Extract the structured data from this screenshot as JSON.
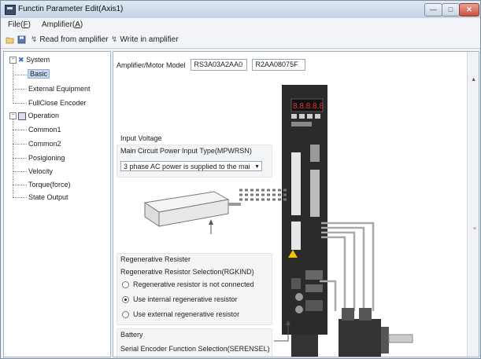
{
  "window": {
    "title": "Functin Parameter Edit(Axis1)"
  },
  "menu": [
    {
      "label": "File(",
      "key": "F",
      "suffix": ")"
    },
    {
      "label": "Amplifier(",
      "key": "A",
      "suffix": ")"
    }
  ],
  "toolbar": {
    "read_label": "Read from amplifier",
    "write_label": "Write in amplifier"
  },
  "tree": {
    "system": "System",
    "system_children": [
      "Basic",
      "External Equipment",
      "FullClose Encoder"
    ],
    "operation": "Operation",
    "operation_children": [
      "Common1",
      "Common2",
      "Posigioning",
      "Velocity",
      "Torque(force)",
      "State Output"
    ]
  },
  "model": {
    "label": "Amplifier/Motor Model",
    "amplifier": "RS3A03A2AA0",
    "motor": "R2AA08075F"
  },
  "input_voltage": {
    "title": "Input Voltage",
    "label": "Main Circuit Power Input Type(MPWRSN)",
    "value": "3 phase AC power is supplied to the mai"
  },
  "regen": {
    "title": "Regenerative Resister",
    "label": "Regenerative Resistor Selection(RGKIND)",
    "options": [
      "Regenerative resistor is not connected",
      "Use internal regenerative resistor",
      "Use external regenerative resistor"
    ],
    "selected_index": 1
  },
  "battery": {
    "title": "Battery",
    "label": "Serial Encoder Function Selection(SERENSEL)"
  },
  "amp_display": "8.8.8.8.8",
  "colors": {
    "selection": "#c5d9f0",
    "title_gradient_top": "#dfe8f2",
    "close": "#c9503a"
  }
}
